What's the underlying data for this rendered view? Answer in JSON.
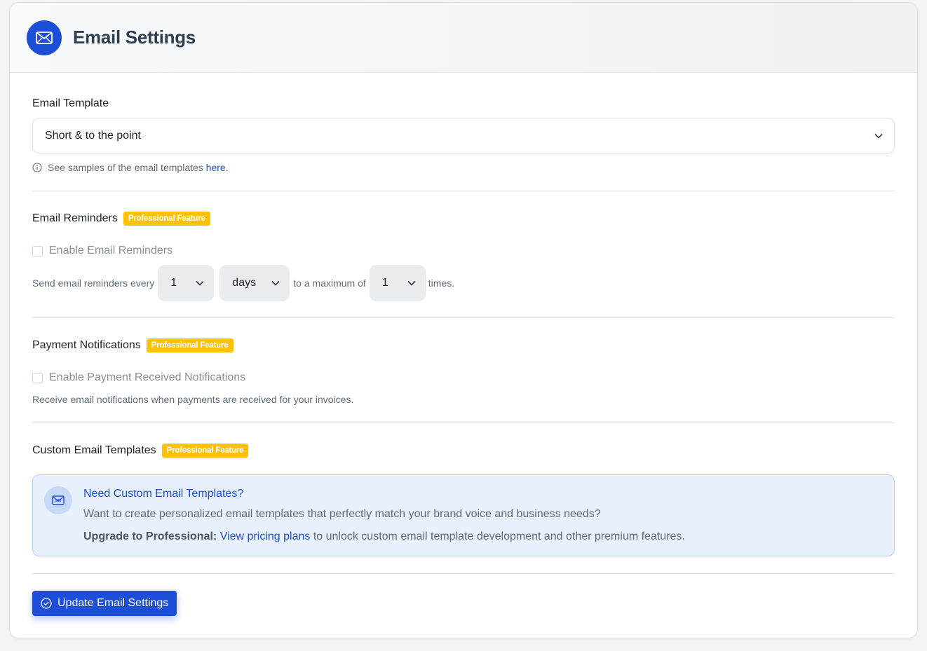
{
  "header": {
    "title": "Email Settings",
    "icon": "envelope-icon"
  },
  "template": {
    "label": "Email Template",
    "selected": "Short & to the point",
    "hint_text": "See samples of the email templates ",
    "hint_link": "here",
    "hint_end": "."
  },
  "reminders": {
    "label": "Email Reminders",
    "badge": "Professional Feature",
    "checkbox_label": "Enable Email Reminders",
    "checked": false,
    "prefix": "Send email reminders every",
    "interval_value": "1",
    "interval_unit": "days",
    "middle": "to a maximum of",
    "max_value": "1",
    "suffix": "times."
  },
  "payments": {
    "label": "Payment Notifications",
    "badge": "Professional Feature",
    "checkbox_label": "Enable Payment Received Notifications",
    "checked": false,
    "description": "Receive email notifications when payments are received for your invoices."
  },
  "custom_templates": {
    "label": "Custom Email Templates",
    "badge": "Professional Feature",
    "info_title": "Need Custom Email Templates?",
    "info_text": "Want to create personalized email templates that perfectly match your brand voice and business needs?",
    "upgrade_label": "Upgrade to Professional:",
    "upgrade_link": "View pricing plans",
    "upgrade_rest": " to unlock custom email template development and other premium features."
  },
  "submit": {
    "label": "Update Email Settings"
  },
  "colors": {
    "primary": "#1d4ed8",
    "badge": "#ffc107",
    "info_bg": "#e8effd"
  }
}
